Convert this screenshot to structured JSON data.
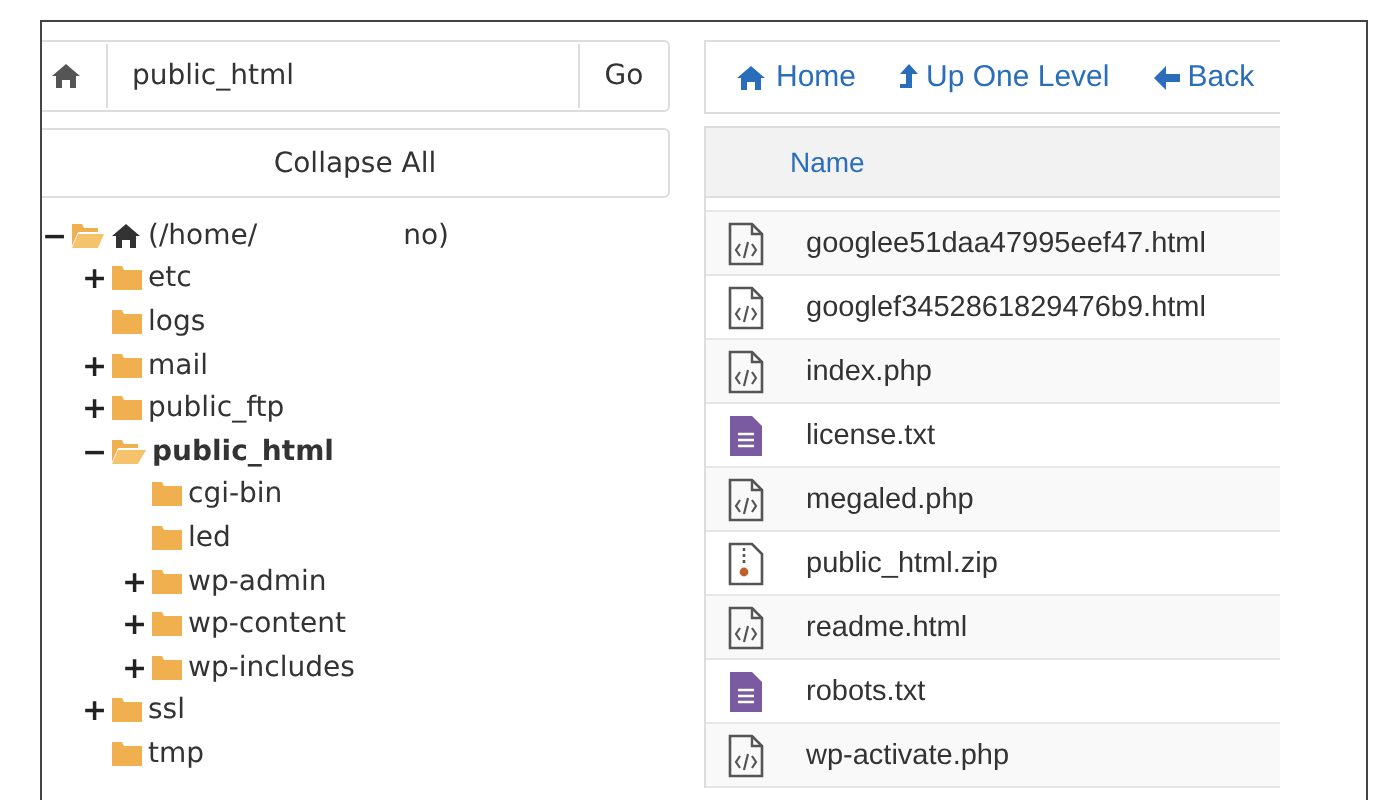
{
  "path_bar": {
    "value": "public_html",
    "go": "Go"
  },
  "collapse_button": "Collapse All",
  "tree": [
    {
      "label": "(/home/",
      "label_tail": "no)",
      "kind": "home",
      "toggle": "−",
      "expanded": true,
      "selected": false,
      "children": [
        {
          "label": "etc",
          "toggle": "+",
          "expanded": false,
          "selected": false
        },
        {
          "label": "logs",
          "expanded": false,
          "selected": false
        },
        {
          "label": "mail",
          "toggle": "+",
          "expanded": false,
          "selected": false
        },
        {
          "label": "public_ftp",
          "toggle": "+",
          "expanded": false,
          "selected": false
        },
        {
          "label": "public_html",
          "toggle": "−",
          "expanded": true,
          "selected": true,
          "children": [
            {
              "label": "cgi-bin",
              "expanded": false,
              "selected": false
            },
            {
              "label": "led",
              "expanded": false,
              "selected": false
            },
            {
              "label": "wp-admin",
              "toggle": "+",
              "expanded": false,
              "selected": false
            },
            {
              "label": "wp-content",
              "toggle": "+",
              "expanded": false,
              "selected": false
            },
            {
              "label": "wp-includes",
              "toggle": "+",
              "expanded": false,
              "selected": false
            }
          ]
        },
        {
          "label": "ssl",
          "toggle": "+",
          "expanded": false,
          "selected": false
        },
        {
          "label": "tmp",
          "expanded": false,
          "selected": false
        }
      ]
    }
  ],
  "toolbar": [
    {
      "label": "Home",
      "kind": "home"
    },
    {
      "label": "Up One Level",
      "kind": "up"
    },
    {
      "label": "Back",
      "kind": "back"
    }
  ],
  "table": {
    "columns": [
      "Name"
    ],
    "rows": [
      {
        "name": "googlee51daa47995eef47.html",
        "kind": "code"
      },
      {
        "name": "googlef3452861829476b9.html",
        "kind": "code"
      },
      {
        "name": "index.php",
        "kind": "code"
      },
      {
        "name": "license.txt",
        "kind": "text"
      },
      {
        "name": "megaled.php",
        "kind": "code"
      },
      {
        "name": "public_html.zip",
        "kind": "zip"
      },
      {
        "name": "readme.html",
        "kind": "code"
      },
      {
        "name": "robots.txt",
        "kind": "text"
      },
      {
        "name": "wp-activate.php",
        "kind": "code"
      }
    ]
  }
}
